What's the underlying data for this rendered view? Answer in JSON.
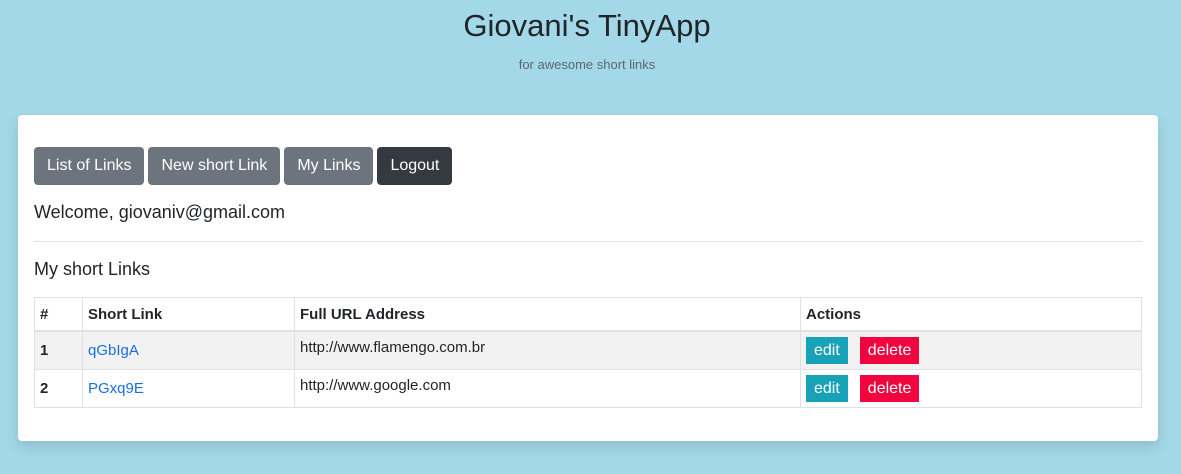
{
  "header": {
    "title": "Giovani's TinyApp",
    "subtitle": "for awesome short links"
  },
  "nav": {
    "list_label": "List of Links",
    "new_label": "New short Link",
    "my_label": "My Links",
    "logout_label": "Logout"
  },
  "welcome": "Welcome, giovaniv@gmail.com",
  "section_title": "My short Links",
  "table": {
    "headers": [
      "#",
      "Short Link",
      "Full URL Address",
      "Actions"
    ],
    "rows": [
      {
        "num": "1",
        "short": "qGbIgA",
        "full": "http://www.flamengo.com.br",
        "edit": "edit",
        "delete": "delete"
      },
      {
        "num": "2",
        "short": "PGxq9E",
        "full": "http://www.google.com",
        "edit": "edit",
        "delete": "delete"
      }
    ]
  },
  "colors": {
    "background": "#a3d8e8",
    "nav_button": "#6c757d",
    "logout_button": "#343a40",
    "edit_button": "#17a2b8",
    "delete_button": "#f0053e",
    "link": "#1a6fe0"
  }
}
